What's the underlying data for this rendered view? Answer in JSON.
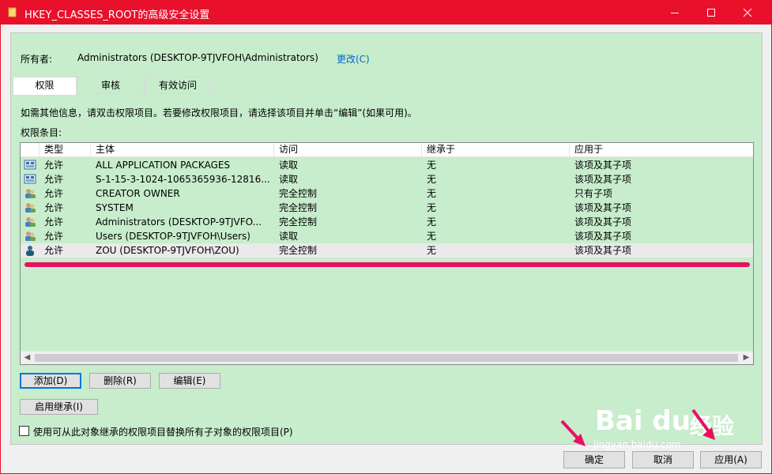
{
  "window": {
    "title": "HKEY_CLASSES_ROOT的高级安全设置",
    "title_color": "#e8102b"
  },
  "owner": {
    "label": "所有者:",
    "value": "Administrators (DESKTOP-9TJVFOH\\Administrators)",
    "change_link": "更改(C)"
  },
  "tabs": [
    {
      "label": "权限",
      "active": true
    },
    {
      "label": "审核",
      "active": false
    },
    {
      "label": "有效访问",
      "active": false
    }
  ],
  "info_text": "如需其他信息，请双击权限项目。若要修改权限项目，请选择该项目并单击“编辑”(如果可用)。",
  "entries_label": "权限条目:",
  "table": {
    "columns": [
      "类型",
      "主体",
      "访问",
      "继承于",
      "应用于"
    ],
    "rows": [
      {
        "icon": "app-package-icon",
        "type": "允许",
        "principal": "ALL APPLICATION PACKAGES",
        "access": "读取",
        "inherited": "无",
        "applies": "该项及其子项"
      },
      {
        "icon": "app-package-icon",
        "type": "允许",
        "principal": "S-1-15-3-1024-1065365936-12816...",
        "access": "读取",
        "inherited": "无",
        "applies": "该项及其子项"
      },
      {
        "icon": "user-group-icon",
        "type": "允许",
        "principal": "CREATOR OWNER",
        "access": "完全控制",
        "inherited": "无",
        "applies": "只有子项"
      },
      {
        "icon": "user-group-icon",
        "type": "允许",
        "principal": "SYSTEM",
        "access": "完全控制",
        "inherited": "无",
        "applies": "该项及其子项"
      },
      {
        "icon": "user-group-icon",
        "type": "允许",
        "principal": "Administrators (DESKTOP-9TJVFO...",
        "access": "完全控制",
        "inherited": "无",
        "applies": "该项及其子项"
      },
      {
        "icon": "user-group-icon",
        "type": "允许",
        "principal": "Users (DESKTOP-9TJVFOH\\Users)",
        "access": "读取",
        "inherited": "无",
        "applies": "该项及其子项"
      },
      {
        "icon": "user-icon",
        "type": "允许",
        "principal": "ZOU (DESKTOP-9TJVFOH\\ZOU)",
        "access": "完全控制",
        "inherited": "无",
        "applies": "该项及其子项",
        "selected": true
      }
    ]
  },
  "buttons": {
    "add": "添加(D)",
    "remove": "删除(R)",
    "edit": "编辑(E)",
    "enable_inheritance": "启用继承(I)",
    "replace_checkbox_label": "使用可从此对象继承的权限项目替换所有子对象的权限项目(P)",
    "ok": "确定",
    "cancel": "取消",
    "apply": "应用(A)"
  },
  "colors": {
    "panel_bg": "#c7edcc",
    "annotation": "#e8105f",
    "link": "#0066cc"
  },
  "watermark": {
    "logo": "Bai du",
    "logo_suffix": "经验",
    "url": "jingyan.baidu.com"
  }
}
